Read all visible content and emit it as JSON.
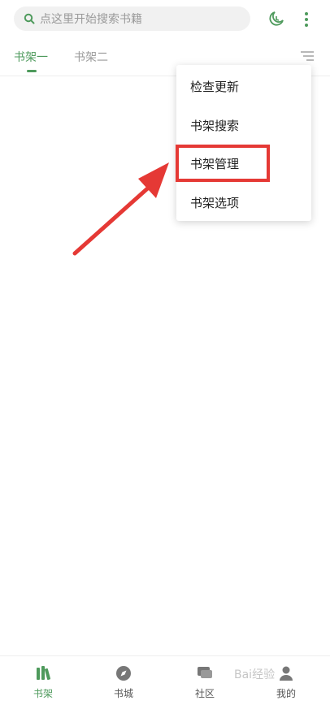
{
  "search": {
    "placeholder": "点这里开始搜索书籍"
  },
  "tabs": [
    {
      "label": "书架一"
    },
    {
      "label": "书架二"
    }
  ],
  "menu": {
    "items": [
      {
        "label": "检查更新"
      },
      {
        "label": "书架搜索"
      },
      {
        "label": "书架管理"
      },
      {
        "label": "书架选项"
      }
    ]
  },
  "bottom_nav": {
    "items": [
      {
        "label": "书架",
        "icon": "bookshelf-icon"
      },
      {
        "label": "书城",
        "icon": "compass-icon"
      },
      {
        "label": "社区",
        "icon": "chat-icon"
      },
      {
        "label": "我的",
        "icon": "person-icon"
      }
    ]
  },
  "watermark": "Bai经验",
  "colors": {
    "accent": "#4e9a5c",
    "annotation": "#e53935"
  }
}
